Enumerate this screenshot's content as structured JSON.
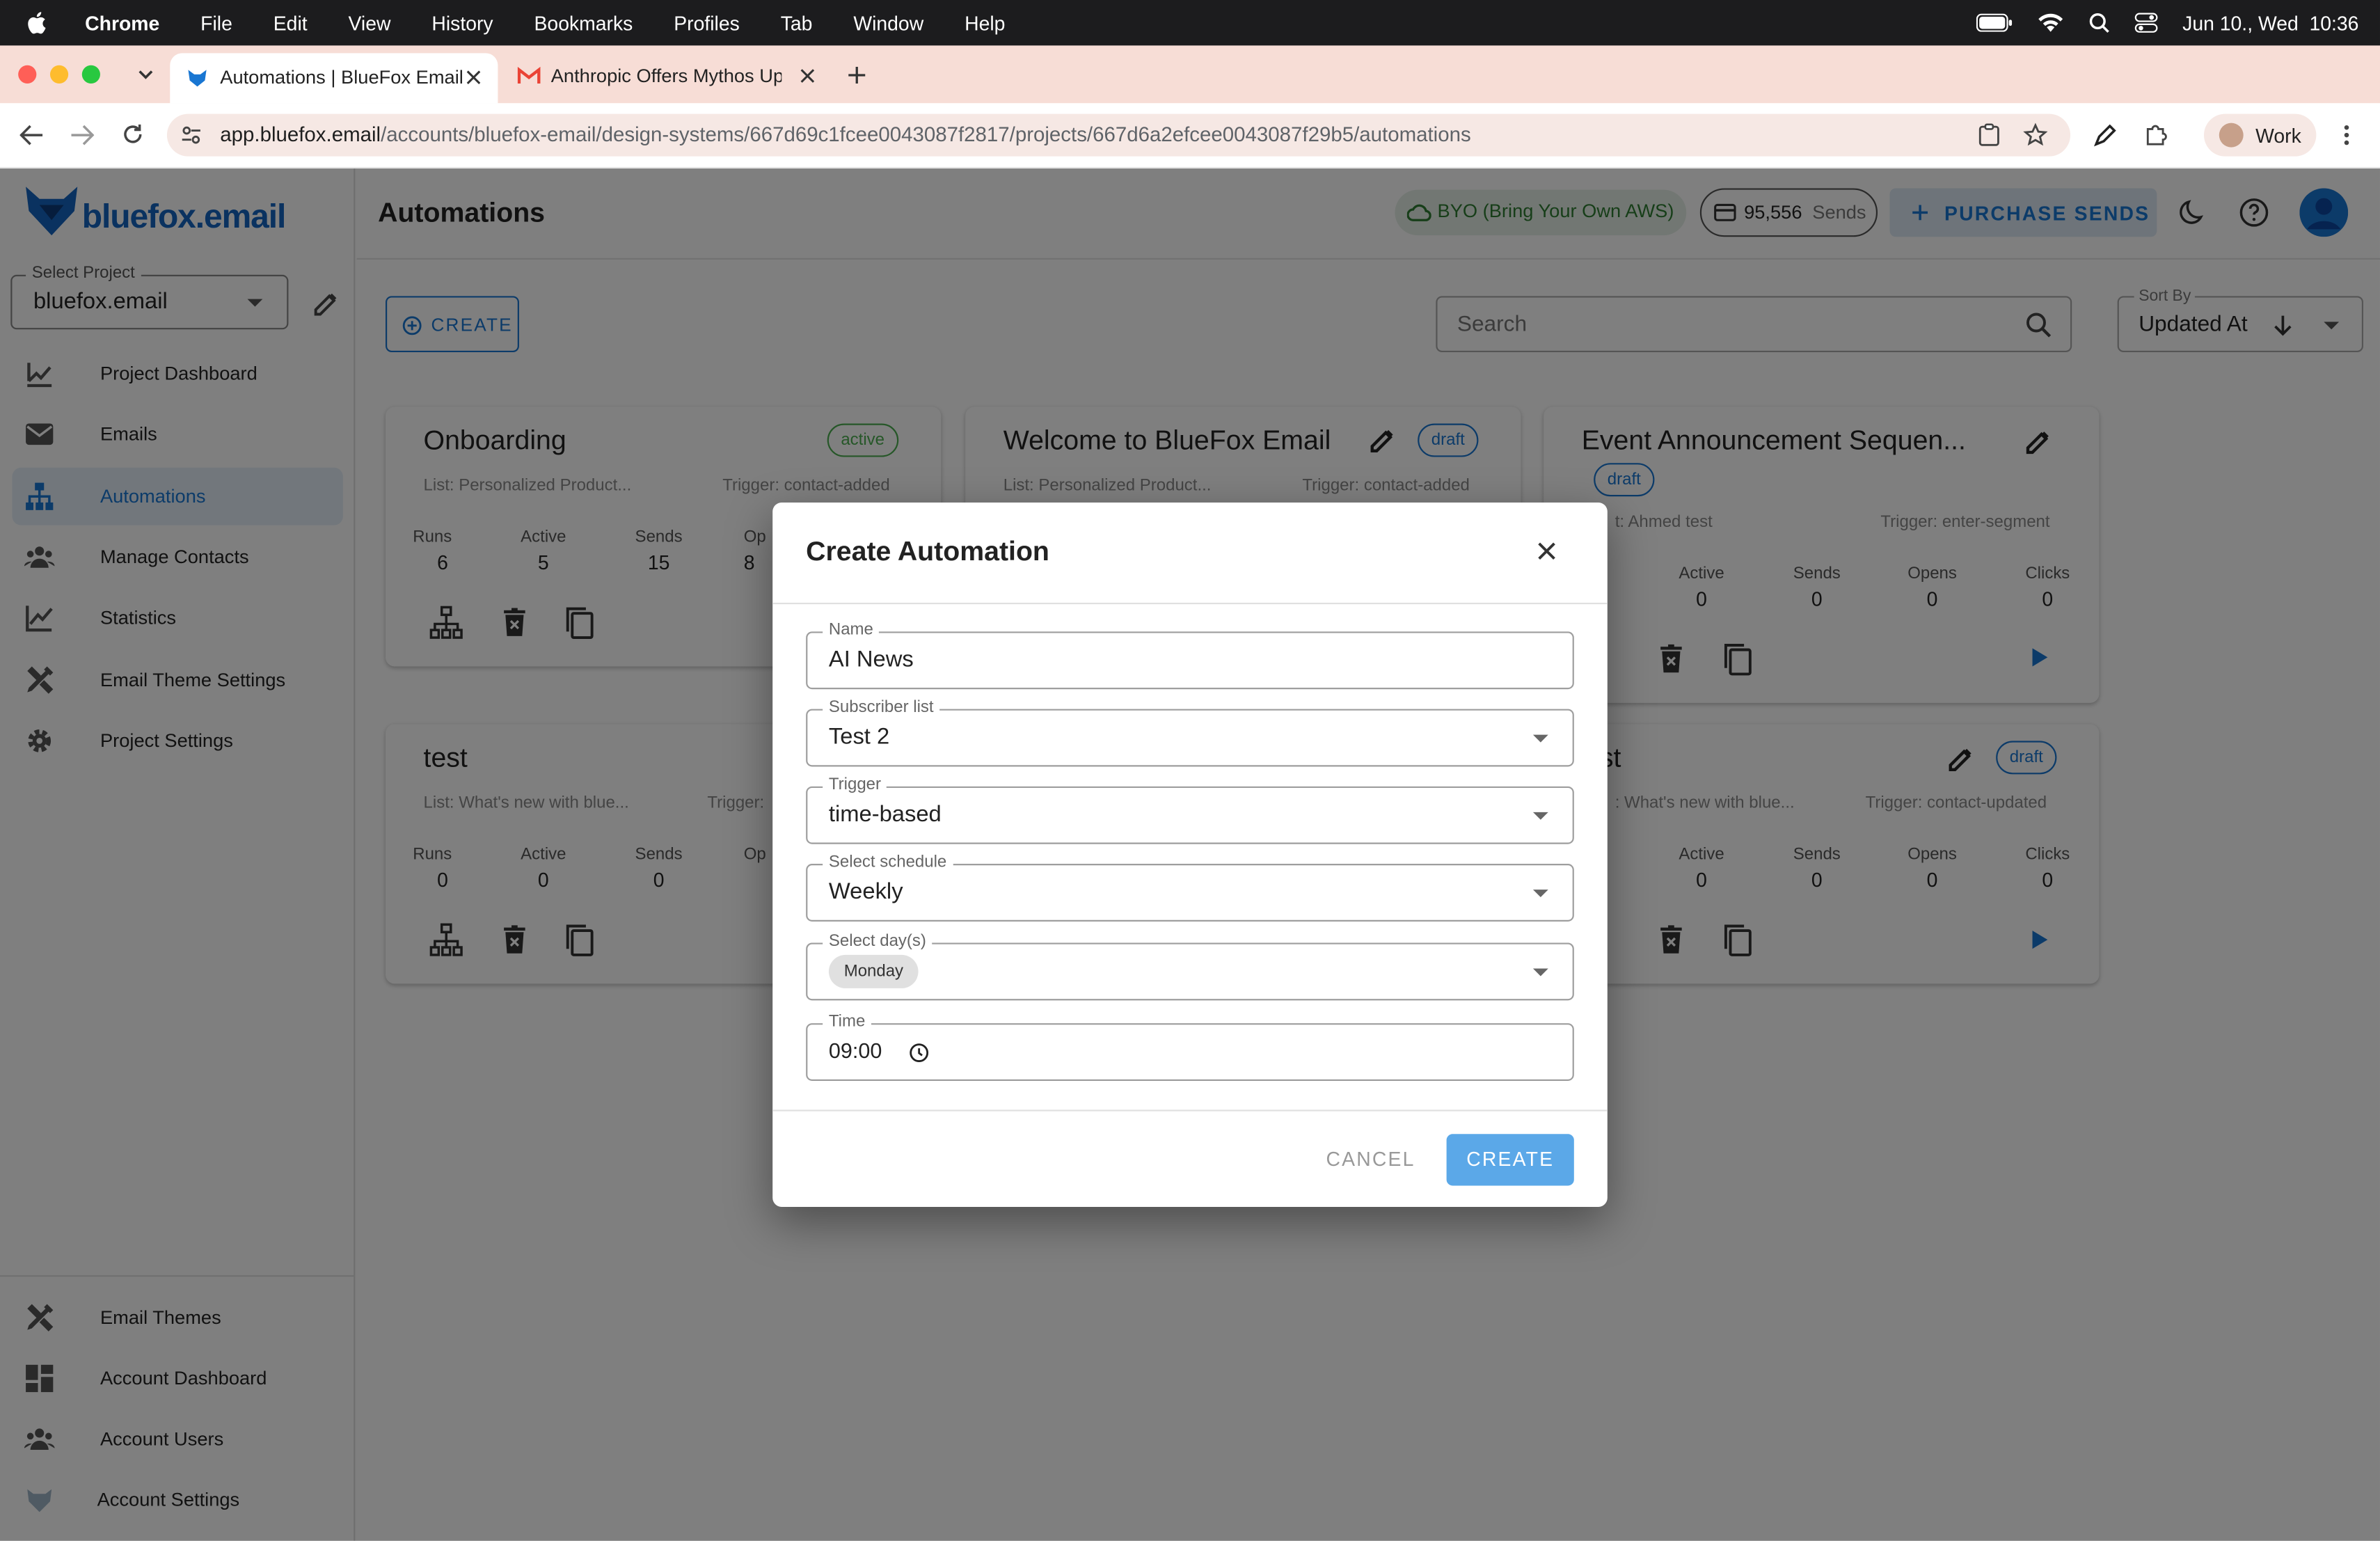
{
  "menubar": {
    "app_name": "Chrome",
    "items": [
      "File",
      "Edit",
      "View",
      "History",
      "Bookmarks",
      "Profiles",
      "Tab",
      "Window",
      "Help"
    ],
    "datetime": "Jun 10., Wed  10:36"
  },
  "browser": {
    "tabs": [
      {
        "label": "Automations | BlueFox Email"
      },
      {
        "label": "Anthropic Offers Mythos Upg"
      }
    ],
    "url_host": "app.bluefox.email",
    "url_path": "/accounts/bluefox-email/design-systems/667d69c1fcee0043087f2817/projects/667d6a2efcee0043087f29b5/automations",
    "profile_label": "Work"
  },
  "sidebar": {
    "logo_text": "bluefox.email",
    "project_select_label": "Select Project",
    "project_select_value": "bluefox.email",
    "items": [
      {
        "label": "Project Dashboard"
      },
      {
        "label": "Emails"
      },
      {
        "label": "Automations"
      },
      {
        "label": "Manage Contacts"
      },
      {
        "label": "Statistics"
      },
      {
        "label": "Email Theme Settings"
      },
      {
        "label": "Project Settings"
      }
    ],
    "bottom_items": [
      {
        "label": "Email Themes"
      },
      {
        "label": "Account Dashboard"
      },
      {
        "label": "Account Users"
      },
      {
        "label": "Account Settings"
      }
    ]
  },
  "header": {
    "title": "Automations",
    "byo_label": "BYO (Bring Your Own AWS)",
    "sends_count": "95,556",
    "sends_suffix": "Sends",
    "purchase_label": "PURCHASE SENDS"
  },
  "toolbar": {
    "create_label": "CREATE",
    "search_placeholder": "Search",
    "sort_label": "Sort By",
    "sort_value": "Updated At"
  },
  "cards": [
    {
      "title": "Onboarding",
      "status": "active",
      "list": "List: Personalized Product...",
      "trigger": "Trigger: contact-added",
      "runs_label": "Runs",
      "runs": "6",
      "active_label": "Active",
      "active": "5",
      "sends_label": "Sends",
      "sends": "15",
      "opens_partial": "Op",
      "opens_digit": "8"
    },
    {
      "title": "Welcome to BlueFox Email",
      "status": "draft",
      "list": "List: Personalized Product...",
      "trigger": "Trigger: contact-added"
    },
    {
      "title": "Event Announcement Sequen...",
      "status": "draft",
      "list": "t: Ahmed test",
      "trigger": "Trigger: enter-segment",
      "active_label": "Active",
      "active": "0",
      "sends_label": "Sends",
      "sends": "0",
      "opens_label": "Opens",
      "opens": "0",
      "clicks_label": "Clicks",
      "clicks": "0"
    },
    {
      "title": "test",
      "list": "List: What's new with blue...",
      "trigger": "Trigger:",
      "runs_label": "Runs",
      "runs": "0",
      "active_label": "Active",
      "active": "0",
      "sends_label": "Sends",
      "sends": "0",
      "opens_partial": "Op"
    },
    {
      "title": "st",
      "status": "draft",
      "list": ": What's new with blue...",
      "trigger": "Trigger: contact-updated",
      "active_label": "Active",
      "active": "0",
      "sends_label": "Sends",
      "sends": "0",
      "opens_label": "Opens",
      "opens": "0",
      "clicks_label": "Clicks",
      "clicks": "0"
    }
  ],
  "dialog": {
    "title": "Create Automation",
    "name_label": "Name",
    "name_value": "AI News",
    "list_label": "Subscriber list",
    "list_value": "Test 2",
    "trigger_label": "Trigger",
    "trigger_value": "time-based",
    "schedule_label": "Select schedule",
    "schedule_value": "Weekly",
    "days_label": "Select day(s)",
    "days_chip": "Monday",
    "time_label": "Time",
    "time_value": "09:00",
    "cancel_label": "CANCEL",
    "create_label": "CREATE"
  },
  "colors": {
    "accent": "#1976d2",
    "active_nav_bg": "#e5eff9",
    "create_button": "#5ba8e8",
    "chrome_tab_bar": "#f7ddd6"
  }
}
